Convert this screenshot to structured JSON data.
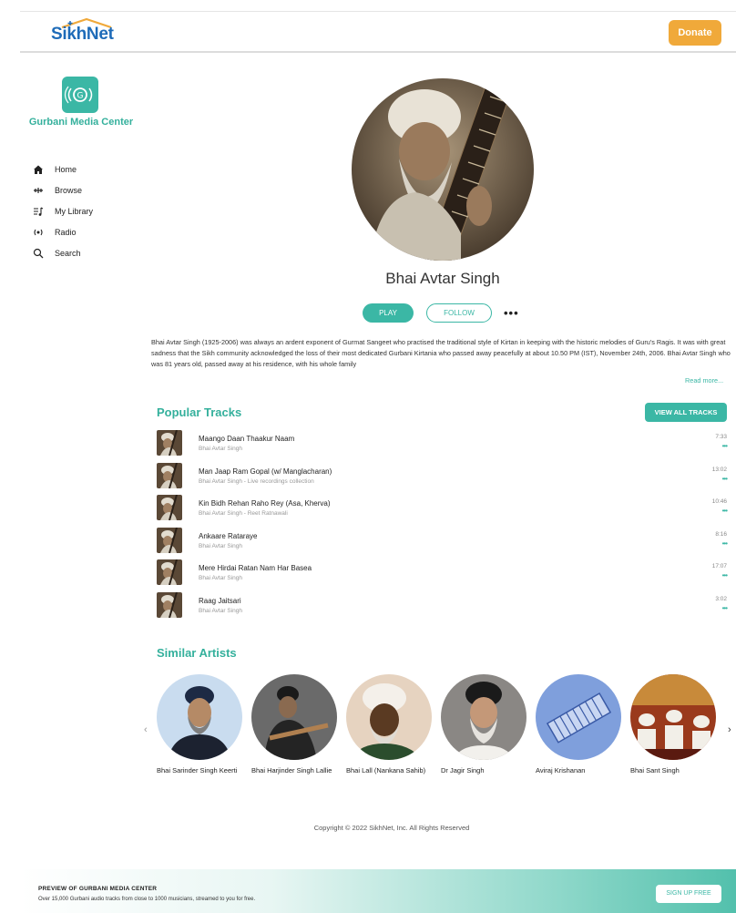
{
  "header": {
    "logo_text": "SikhNet",
    "donate_label": "Donate"
  },
  "sidebar": {
    "brand": "Gurbani Media Center",
    "items": [
      {
        "label": "Home",
        "icon": "home-icon"
      },
      {
        "label": "Browse",
        "icon": "browse-icon"
      },
      {
        "label": "My Library",
        "icon": "library-icon"
      },
      {
        "label": "Radio",
        "icon": "radio-icon"
      },
      {
        "label": "Search",
        "icon": "search-icon"
      }
    ]
  },
  "artist": {
    "name": "Bhai Avtar Singh",
    "play_label": "PLAY",
    "follow_label": "FOLLOW",
    "more_label": "•••",
    "bio": "Bhai Avtar Singh (1925-2006) was always an ardent exponent of Gurmat Sangeet who practised the traditional style of Kirtan in keeping with the historic melodies of Guru's Ragis. It was with great sadness that the Sikh community acknowledged the loss of their most dedicated Gurbani Kirtania who passed away peacefully at about 10.50 PM (IST), November 24th, 2006. Bhai Avtar Singh who was 81 years old, passed away at his residence, with his whole family",
    "read_more": "Read more..."
  },
  "popular": {
    "title": "Popular Tracks",
    "view_all_label": "VIEW ALL TRACKS",
    "tracks": [
      {
        "title": "Maango Daan Thaakur Naam",
        "subtitle": "Bhai Avtar Singh",
        "duration": "7:33",
        "more": "•••"
      },
      {
        "title": "Man Jaap Ram Gopal (w/ Manglacharan)",
        "subtitle": "Bhai Avtar Singh - Live recordings collection",
        "duration": "13:02",
        "more": "•••"
      },
      {
        "title": "Kin Bidh Rehan Raho Rey (Asa, Kherva)",
        "subtitle": "Bhai Avtar Singh - Reet Ratnawali",
        "duration": "10:46",
        "more": "•••"
      },
      {
        "title": "Ankaare Rataraye",
        "subtitle": "Bhai Avtar Singh",
        "duration": "8:16",
        "more": "•••"
      },
      {
        "title": "Mere Hirdai Ratan Nam Har Basea",
        "subtitle": "Bhai Avtar Singh",
        "duration": "17:07",
        "more": "•••"
      },
      {
        "title": "Raag Jaitsari",
        "subtitle": "Bhai Avtar Singh",
        "duration": "3:02",
        "more": "•••"
      }
    ]
  },
  "similar": {
    "title": "Similar Artists",
    "prev": "‹",
    "next": "›",
    "artists": [
      {
        "name": "Bhai Sarinder Singh Keerti"
      },
      {
        "name": "Bhai Harjinder Singh Lallie"
      },
      {
        "name": "Bhai Lall (Nankana Sahib)"
      },
      {
        "name": "Dr Jagir Singh"
      },
      {
        "name": "Aviraj Krishanan"
      },
      {
        "name": "Bhai Sant Singh"
      }
    ]
  },
  "footer": {
    "copyright": "Copyright © 2022 SikhNet, Inc. All Rights Reserved",
    "banner_title": "PREVIEW OF GURBANI MEDIA CENTER",
    "banner_sub": "Over 15,000 Gurbani audio tracks from close to 1000 musicians, streamed to you for free.",
    "signup_label": "SIGN UP FREE"
  },
  "colors": {
    "accent": "#3bb7a5",
    "donate": "#f0a93a",
    "logo_blue": "#1e6bb8"
  }
}
